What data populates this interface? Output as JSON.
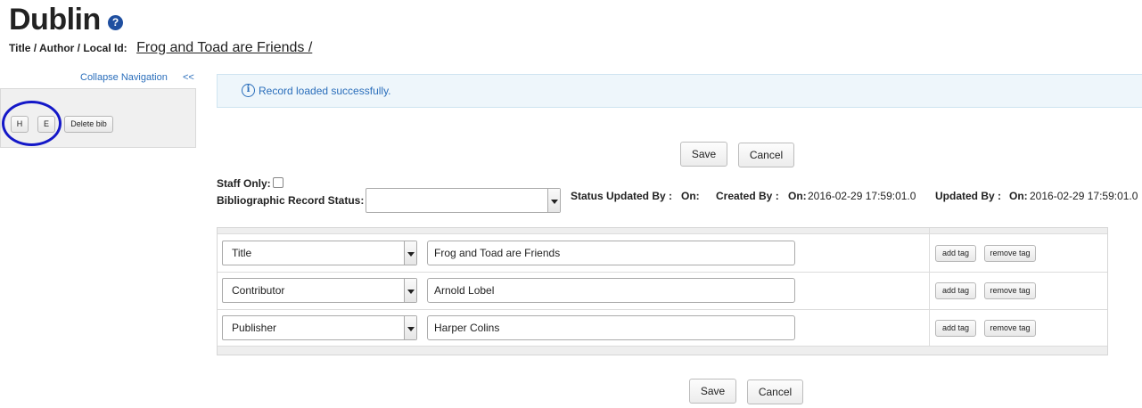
{
  "header": {
    "title": "Dublin",
    "help_icon": "?",
    "id_label": "Title / Author / Local Id:",
    "id_value": "Frog and Toad are Friends /"
  },
  "sidebar": {
    "collapse_label": "Collapse Navigation",
    "collapse_arrows": "<<",
    "buttons": {
      "h": "H",
      "e": "E",
      "delete_bib": "Delete bib"
    },
    "highlight_color": "#1418c8"
  },
  "alert": {
    "icon": "i",
    "message": "Record loaded successfully."
  },
  "actions": {
    "save": "Save",
    "cancel": "Cancel"
  },
  "meta": {
    "staff_only_label": "Staff Only:",
    "bib_status_label": "Bibliographic Record Status:",
    "bib_status_value": "",
    "status_updated_by_label": "Status Updated By :",
    "status_on_label": "On:",
    "created_by_label": "Created By :",
    "created_on_label": "On:",
    "created_on_value": "2016-02-29 17:59:01.0",
    "updated_by_label": "Updated By :",
    "updated_on_label": "On:",
    "updated_on_value": "2016-02-29 17:59:01.0"
  },
  "tags": {
    "add_label": "add tag",
    "remove_label": "remove tag",
    "rows": [
      {
        "field": "Title",
        "value": "Frog and Toad are Friends"
      },
      {
        "field": "Contributor",
        "value": "Arnold Lobel"
      },
      {
        "field": "Publisher",
        "value": "Harper Colins"
      }
    ]
  },
  "colors": {
    "link": "#2a6ebb",
    "alert_bg": "#eef6fb",
    "help_icon": "#1f4fa0"
  }
}
